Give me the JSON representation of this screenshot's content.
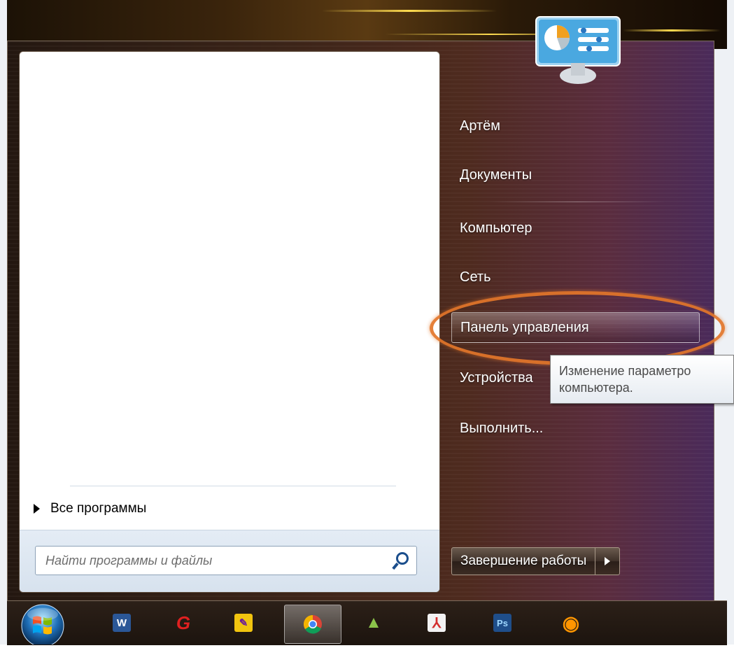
{
  "right_menu": {
    "items": [
      {
        "label": "Артём"
      },
      {
        "label": "Документы"
      },
      {
        "label": "Компьютер"
      },
      {
        "label": "Сеть"
      },
      {
        "label": "Панель управления"
      },
      {
        "label": "Устройства"
      },
      {
        "label": "Выполнить..."
      }
    ]
  },
  "tooltip": {
    "line1": "Изменение параметро",
    "line2": "компьютера."
  },
  "left_panel": {
    "all_programs": "Все программы",
    "search_placeholder": "Найти программы и файлы"
  },
  "shutdown": {
    "label": "Завершение работы"
  },
  "taskbar": {
    "icons": [
      {
        "icon": "word-icon",
        "glyph": "W",
        "color": "#2b5797"
      },
      {
        "icon": "app-g-icon",
        "glyph": "G",
        "color": "#d81e1e"
      },
      {
        "icon": "paint-icon",
        "glyph": "✎",
        "color": "#8a2be2"
      },
      {
        "icon": "chrome-icon",
        "glyph": "●",
        "color": "#e8a317"
      },
      {
        "icon": "android-icon",
        "glyph": "▲",
        "color": "#7cb342"
      },
      {
        "icon": "acrobat-icon",
        "glyph": "⅄",
        "color": "#d32f2f"
      },
      {
        "icon": "photoshop-icon",
        "glyph": "Ps",
        "color": "#1f4e8a"
      },
      {
        "icon": "firefox-icon",
        "glyph": "◉",
        "color": "#e66000"
      }
    ]
  },
  "colors": {
    "highlight_ring": "#e3762a",
    "menu_bg": "#3c2418",
    "taskbar_bg": "#1c140e"
  }
}
